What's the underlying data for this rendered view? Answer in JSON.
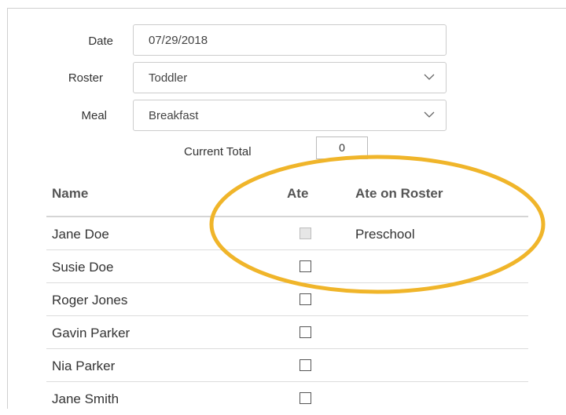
{
  "form": {
    "date_label": "Date",
    "date_value": "07/29/2018",
    "roster_label": "Roster",
    "roster_value": "Toddler",
    "meal_label": "Meal",
    "meal_value": "Breakfast",
    "current_total_label": "Current Total",
    "current_total_value": "0",
    "dropdown_icon": "chevron-down-icon"
  },
  "table": {
    "columns": [
      "Name",
      "Ate",
      "Ate on Roster"
    ],
    "rows": [
      {
        "name": "Jane Doe",
        "ate": false,
        "ate_disabled": true,
        "ate_on_roster": "Preschool"
      },
      {
        "name": "Susie Doe",
        "ate": false,
        "ate_disabled": false,
        "ate_on_roster": ""
      },
      {
        "name": "Roger Jones",
        "ate": false,
        "ate_disabled": false,
        "ate_on_roster": ""
      },
      {
        "name": "Gavin Parker",
        "ate": false,
        "ate_disabled": false,
        "ate_on_roster": ""
      },
      {
        "name": "Nia Parker",
        "ate": false,
        "ate_disabled": false,
        "ate_on_roster": ""
      },
      {
        "name": "Jane Smith",
        "ate": false,
        "ate_disabled": false,
        "ate_on_roster": ""
      }
    ]
  },
  "colors": {
    "annotation_ellipse": "#f0b52a"
  }
}
